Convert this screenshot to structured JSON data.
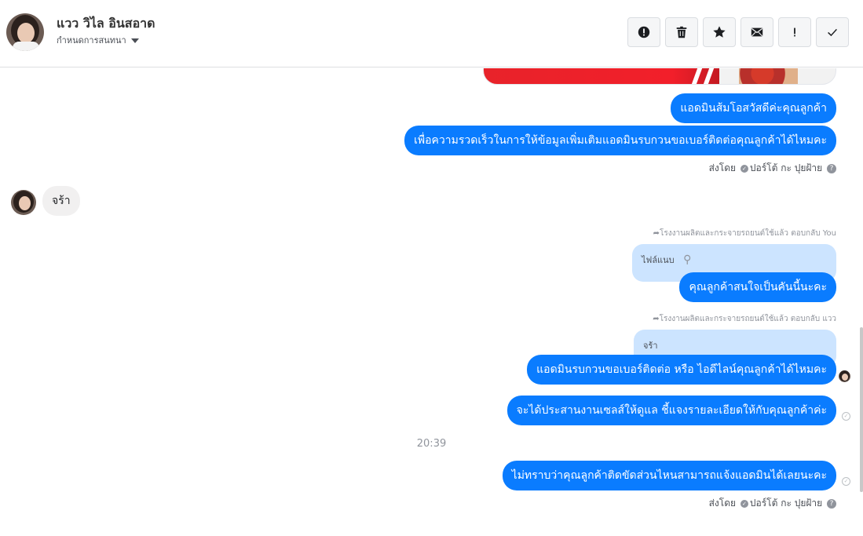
{
  "header": {
    "contact_name": "แวว วิไล อินสอาด",
    "assign_label": "กำหนดการสนทนา",
    "actions": [
      {
        "icon": "alert-circle-icon",
        "name": "spam-button"
      },
      {
        "icon": "trash-icon",
        "name": "delete-button"
      },
      {
        "icon": "star-icon",
        "name": "star-button"
      },
      {
        "icon": "envelope-icon",
        "name": "mark-unread-button"
      },
      {
        "icon": "exclamation-icon",
        "name": "follow-up-button"
      },
      {
        "icon": "check-icon",
        "name": "mark-done-button"
      }
    ]
  },
  "messages": {
    "m1": "แอดมินส้มโอสวัสดีค่ะคุณลูกค้า",
    "m2": "เพื่อความรวดเร็วในการให้ข้อมูลเพิ่มเติมแอดมินรบกวนขอเบอร์ติดต่อคุณลูกค้าได้ไหมคะ",
    "sent_by_1": {
      "prefix": "ส่งโดย",
      "name": "ปอร์โต้ กะ ปุยฝ้าย"
    },
    "in1": "จร้า",
    "reply1_meta": "โรงงานผลิตและกระจายรถยนต์ใช้แล้ว ตอบกลับ You",
    "reply1_quote": "ไฟล์แนบ",
    "m3": "คุณลูกค้าสนใจเป็นคันนี้นะคะ",
    "reply2_meta": "โรงงานผลิตและกระจายรถยนต์ใช้แล้ว ตอบกลับ แวว",
    "reply2_quote": "จร้า",
    "m4": "แอดมินรบกวนขอเบอร์ติดต่อ หรือ ไอดีไลน์คุณลูกค้าได้ไหมคะ",
    "m5": "จะได้ประสานงานเซลส์ให้ดูแล ชี้แจงรายละเอียดให้กับคุณลูกค้าค่ะ",
    "time": "20:39",
    "m6": "ไม่ทราบว่าคุณลูกค้าติดขัดส่วนไหนสามารถแจ้งแอดมินได้เลยนะคะ",
    "sent_by_2": {
      "prefix": "ส่งโดย",
      "name": "ปอร์โต้ กะ ปุยฝ้าย"
    }
  },
  "colors": {
    "outgoing": "#0a7cff",
    "incoming": "#f1f0f0",
    "quote": "#cce4ff"
  }
}
